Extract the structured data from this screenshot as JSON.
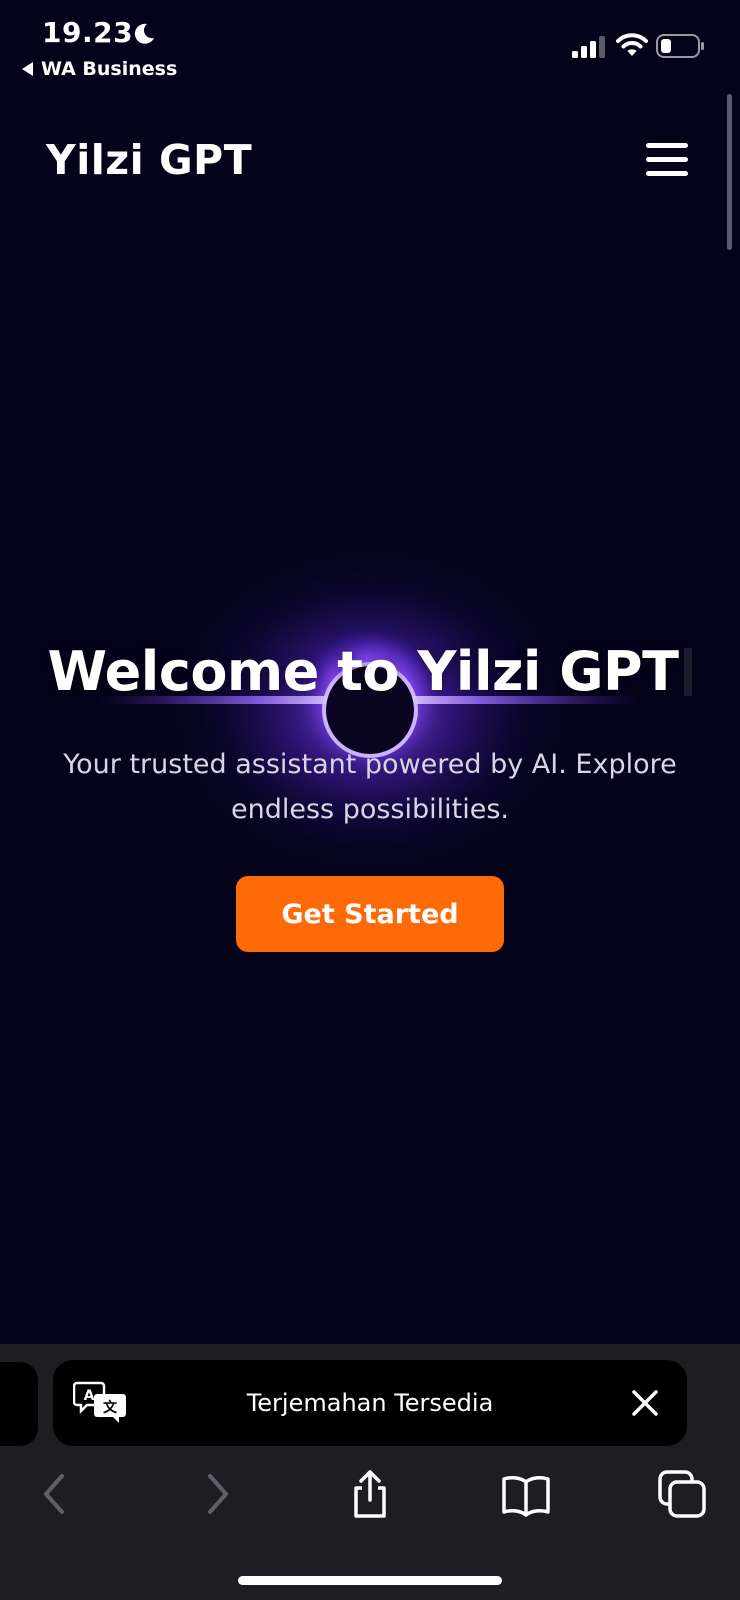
{
  "status_bar": {
    "time": "19.23",
    "back_app": "WA Business"
  },
  "header": {
    "logo": "Yilzi GPT"
  },
  "hero": {
    "title": "Welcome to Yilzi GPT",
    "subtitle_line1": "Your trusted assistant powered by AI. Explore",
    "subtitle_line2": "endless possibilities.",
    "cta_label": "Get Started"
  },
  "translation_banner": {
    "text": "Terjemahan Tersedia"
  },
  "icons": {
    "status": [
      "moon-icon",
      "signal-icon",
      "wifi-icon",
      "battery-icon"
    ],
    "header": [
      "hamburger-menu-icon"
    ],
    "banner": [
      "translate-icon",
      "close-icon"
    ],
    "toolbar": [
      "back-arrow-icon",
      "forward-arrow-icon",
      "share-icon",
      "bookmarks-icon",
      "tabs-icon"
    ]
  },
  "colors": {
    "background": "#04031a",
    "accent": "#ff6a08",
    "glow": "#8b4dff"
  }
}
